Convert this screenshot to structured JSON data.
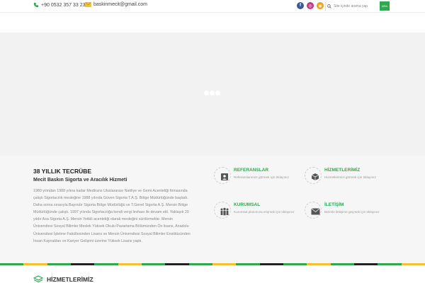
{
  "topbar": {
    "phone": "+90 0532 357 33 23",
    "email": "baskinmecit@gmail.com",
    "social": [
      {
        "name": "facebook-icon",
        "glyph": "f",
        "color": "#3b5998"
      },
      {
        "name": "instagram-icon",
        "glyph": "◎",
        "color": "#c13584"
      },
      {
        "name": "rss-icon",
        "glyph": "◉",
        "color": "#f0a11a"
      }
    ],
    "search_placeholder": "Site içinde arama yap",
    "search_button": "ARA"
  },
  "about": {
    "title": "38 YILLIK TECRÜBE",
    "subtitle": "Mecit Baskın Sigorta ve Aracılık Hizmeti",
    "text": "1980 yılından 1988 yılına kadar Medtrans Uluslararası Nakliye ve Gemi Acenteliği firmasında çalıştı Sigortacılık mesleğine 1988 yılında Güven Sigorta T.A.Ş. Bölge Müdürlüğünde başladı. Daha sonra sırasıyla Bayındır Sigorta Bölge Müdürlüğü ve T.Genel Sigorta A.Ş. Mersin Bölge Müdürlüğünde çalıştı. 1997 yılında Sigortacılığa kendi vergi levhası ile devam etti. Yaklaşık 20 yıldır Axa Sigorta A.Ş. Mersin Yetkili acenteliği olarak mesleğini sürdürmekte. Mersin Üniversitesi Sosyal Bilimler Meslek Yüksek Okulu Pazarlama Bölümünden Ön lisans, Anadolu Üniversitesi İşletme Fakültesinden Lisans ve Mersin Üniversitesi Sosyal Bilimler Enstitüsünden İnsan Kaynakları ve Kariyer Gelişimi üzerine Yüksek Lisans yaptı."
  },
  "features": [
    {
      "title": "REFERANSLAR",
      "desc": "Referanslarımızı görmek için tıklayınız",
      "icon": "contact-card-icon"
    },
    {
      "title": "HİZMETLERİMİZ",
      "desc": "Hizmetlerimizi görmek için tıklayınız",
      "icon": "cube-icon"
    },
    {
      "title": "KURUMSAL",
      "desc": "Kurumsal planımıza erişmek için tıklayınız",
      "icon": "team-icon"
    },
    {
      "title": "İLETİŞİM",
      "desc": "Bizimle iletişime geçmek için tıklayınız",
      "icon": "envelope-icon"
    }
  ],
  "stripe_colors": [
    "#2fa84f",
    "#f2c230",
    "#2fa84f",
    "#222222",
    "#2fa84f",
    "#f2c230",
    "#2fa84f",
    "#222222",
    "#2fa84f",
    "#f2c230",
    "#2fa84f",
    "#222222",
    "#2fa84f",
    "#f2c230",
    "#2fa84f",
    "#222222",
    "#2fa84f",
    "#f2c230"
  ],
  "bottom": {
    "title": "HİZMETLERİMİZ"
  },
  "colors": {
    "accent": "#2fa84f",
    "slider_bg": "#f2f2f2"
  }
}
